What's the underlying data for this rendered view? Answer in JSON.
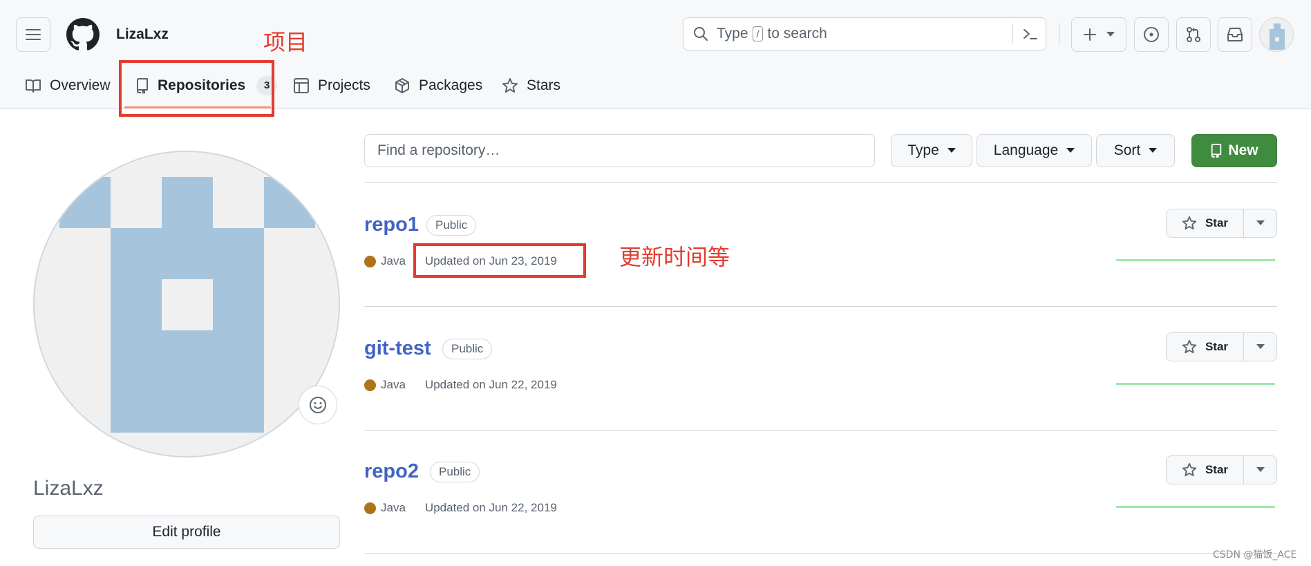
{
  "header": {
    "username": "LizaLxz",
    "search_prefix": "Type",
    "search_key": "/",
    "search_suffix": "to search"
  },
  "tabs": [
    {
      "label": "Overview",
      "icon": "book-icon"
    },
    {
      "label": "Repositories",
      "icon": "repo-icon",
      "count": "3",
      "selected": true
    },
    {
      "label": "Projects",
      "icon": "table-icon"
    },
    {
      "label": "Packages",
      "icon": "package-icon"
    },
    {
      "label": "Stars",
      "icon": "star-icon"
    }
  ],
  "annotations": {
    "tab_note": "项目",
    "updated_note": "更新时间等"
  },
  "sidebar": {
    "name": "LizaLxz",
    "edit_label": "Edit profile"
  },
  "controls": {
    "find_placeholder": "Find a repository…",
    "type_label": "Type",
    "language_label": "Language",
    "sort_label": "Sort",
    "new_label": "New"
  },
  "repos": [
    {
      "name": "repo1",
      "visibility": "Public",
      "language": "Java",
      "updated": "Updated on Jun 23, 2019",
      "star_label": "Star"
    },
    {
      "name": "git-test",
      "visibility": "Public",
      "language": "Java",
      "updated": "Updated on Jun 22, 2019",
      "star_label": "Star"
    },
    {
      "name": "repo2",
      "visibility": "Public",
      "language": "Java",
      "updated": "Updated on Jun 22, 2019",
      "star_label": "Star"
    }
  ],
  "colors": {
    "accent_green": "#3f8b3f",
    "link_blue": "#4163c5",
    "java_color": "#b07219",
    "annotation_red": "#e33b2f",
    "avatar_blue": "#a6c5dc"
  },
  "watermark": "CSDN @猫饭_ACE"
}
